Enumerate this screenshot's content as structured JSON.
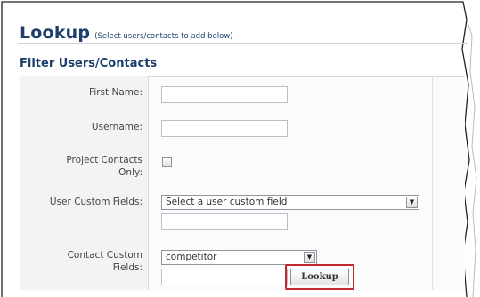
{
  "header": {
    "title": "Lookup",
    "subtitle": "(Select users/contacts to add below)"
  },
  "filter": {
    "section_title": "Filter Users/Contacts",
    "first_name": {
      "label": "First Name:",
      "value": ""
    },
    "username": {
      "label": "Username:",
      "value": ""
    },
    "project_contacts_only": {
      "label_line1": "Project Contacts",
      "label_line2": "Only:",
      "checked": false
    },
    "user_custom_fields": {
      "label": "User Custom Fields:",
      "selected": "Select a user custom field",
      "value": ""
    },
    "contact_custom_fields": {
      "label_line1": "Contact Custom",
      "label_line2": "Fields:",
      "selected": "competitor",
      "value": ""
    },
    "lookup_button": "Lookup"
  },
  "colors": {
    "heading": "#1c3f6e",
    "highlight": "#c0282d"
  },
  "icons": {
    "dropdown": "chevron-down-icon"
  }
}
